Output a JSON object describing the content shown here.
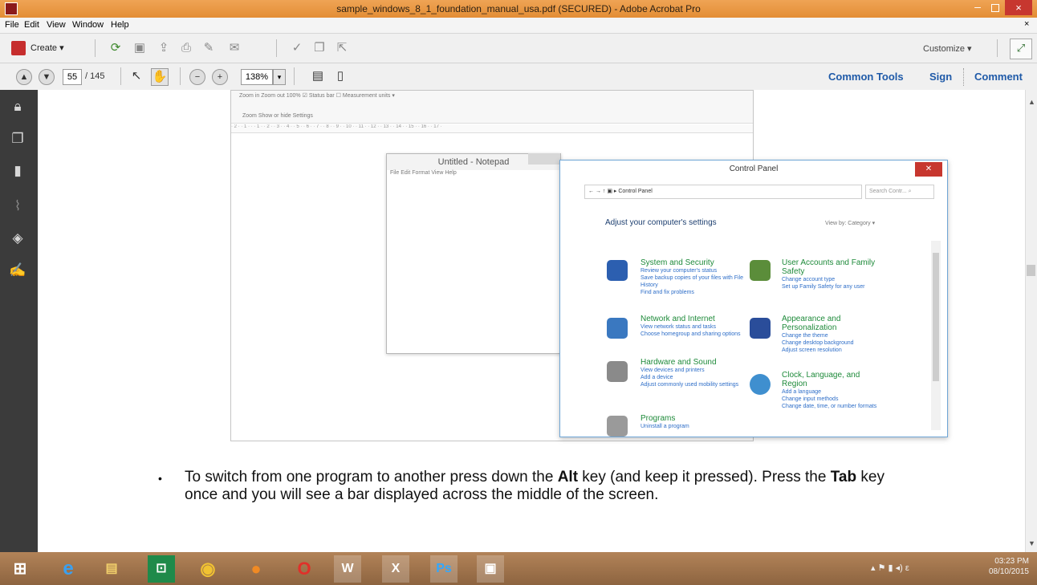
{
  "window": {
    "title": "sample_windows_8_1_foundation_manual_usa.pdf (SECURED) - Adobe Acrobat Pro",
    "close_glyph": "×",
    "minimize_glyph": "–"
  },
  "menu": [
    "File",
    "Edit",
    "View",
    "Window",
    "Help"
  ],
  "menu_close": "×",
  "toolbar1": {
    "create_label": "Create ▾",
    "customize_label": "Customize ▾",
    "expand_glyph": "⤢"
  },
  "toolbar2": {
    "page_current": "55",
    "page_total": "/ 145",
    "zoom": "138%",
    "zoom_arrow": "▾",
    "panes": [
      "Common Tools",
      "Sign",
      "Comment"
    ]
  },
  "nav_icons": [
    "lock-icon",
    "pages-icon",
    "bookmark-icon",
    "attachment-icon",
    "layers-icon",
    "signature-icon"
  ],
  "embedded": {
    "ribbon_text": "Zoom in   Zoom out   100%      ☑ Status bar   ☐ Measurement units ▾",
    "ribbon_groups": "Zoom            Show or hide             Settings",
    "ruler_text": "· 2 · · 1 · · · 1 · · 2 · · 3 · · 4 · · 5 · · 6 · · 7 · · 8 · · 9 · · 10 · · 11 · · 12 · · 13 · · 14 · · 15 · · 16 · · 17 ·",
    "notepad_title": "Untitled - Notepad",
    "notepad_menu": "File   Edit   Format   View   Help",
    "cp_title": "Control Panel",
    "cp_address": "← → ↑  ▣ ▸ Control Panel",
    "cp_search": "Search Contr... ⌕",
    "cp_heading": "Adjust your computer's settings",
    "cp_viewby": "View by:  Category ▾",
    "categories": [
      {
        "title": "System and Security",
        "links": [
          "Review your computer's status",
          "Save backup copies of your files with File History",
          "Find and fix problems"
        ]
      },
      {
        "title": "User Accounts and Family Safety",
        "links": [
          "Change account type",
          "Set up Family Safety for any user"
        ]
      },
      {
        "title": "Network and Internet",
        "links": [
          "View network status and tasks",
          "Choose homegroup and sharing options"
        ]
      },
      {
        "title": "Appearance and Personalization",
        "links": [
          "Change the theme",
          "Change desktop background",
          "Adjust screen resolution"
        ]
      },
      {
        "title": "Hardware and Sound",
        "links": [
          "View devices and printers",
          "Add a device",
          "Adjust commonly used mobility settings"
        ]
      },
      {
        "title": "Clock, Language, and Region",
        "links": [
          "Add a language",
          "Change input methods",
          "Change date, time, or number formats"
        ]
      },
      {
        "title": "Programs",
        "links": [
          "Uninstall a program"
        ]
      }
    ]
  },
  "bullet": {
    "dot": "•",
    "part1": "To switch from one program to another press down the ",
    "key1": "Alt",
    "part2": " key (and keep it pressed).  Press the ",
    "key2": "Tab",
    "part3": " key once and you will see a bar displayed across the middle of the screen."
  },
  "taskbar": {
    "apps": [
      "start-icon",
      "ie-icon",
      "explorer-icon",
      "store-icon",
      "chrome-icon",
      "firefox-icon",
      "opera-icon",
      "word-icon",
      "excel-icon",
      "photoshop-icon",
      "acrobat-icon"
    ],
    "clock_time": "03:23 PM",
    "clock_date": "08/10/2015",
    "tray": "▴  ⚑  ▮  ◂)  ε"
  }
}
